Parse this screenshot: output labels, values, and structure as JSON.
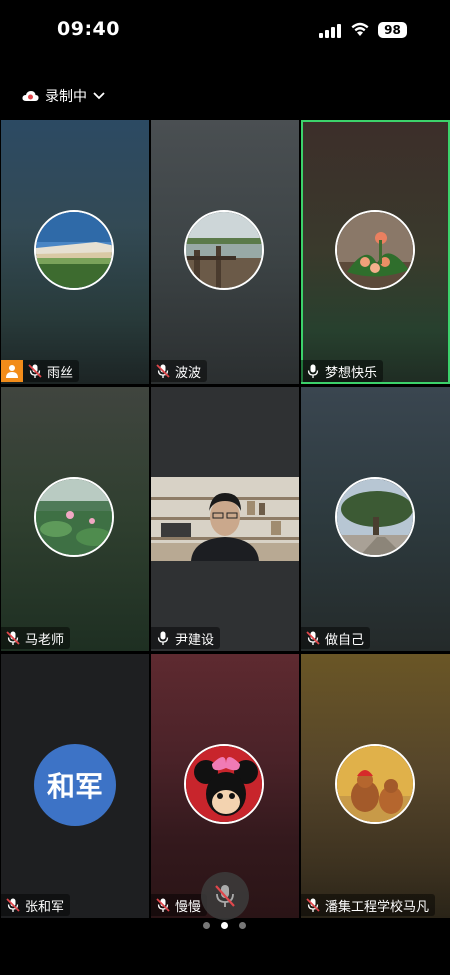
{
  "status_bar": {
    "time": "09:40",
    "battery": "98"
  },
  "recording": {
    "label": "录制中"
  },
  "participants": [
    {
      "name": "雨丝",
      "muted": true,
      "host": true,
      "avatar": "bridge-photo"
    },
    {
      "name": "波波",
      "muted": true,
      "avatar": "pavilion-photo"
    },
    {
      "name": "梦想快乐",
      "muted": false,
      "active_speaker": true,
      "avatar": "flower-photo"
    },
    {
      "name": "马老师",
      "muted": true,
      "avatar": "lotus-photo"
    },
    {
      "name": "尹建设",
      "muted": false,
      "video": true
    },
    {
      "name": "做自己",
      "muted": true,
      "avatar": "tree-photo"
    },
    {
      "name": "张和军",
      "muted": true,
      "initials": "和军",
      "initials_color": "#3d73c6"
    },
    {
      "name": "慢慢",
      "muted": true,
      "avatar": "minnie-photo"
    },
    {
      "name": "潘集工程学校马凡",
      "muted": true,
      "avatar": "dogs-photo"
    }
  ],
  "pager": {
    "pages": 3,
    "current": 2
  },
  "colors": {
    "accent_green": "#3cd26b",
    "host_orange": "#f28c1a",
    "muted_red": "#e0474c"
  }
}
